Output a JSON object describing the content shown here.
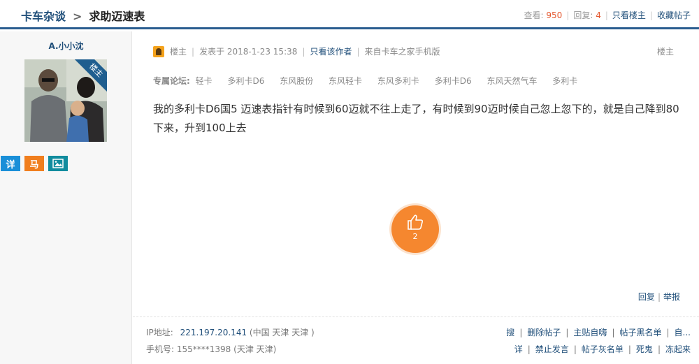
{
  "breadcrumb": {
    "forum": "卡车杂谈",
    "separator": ">",
    "thread_title": "求助迈速表"
  },
  "stats": {
    "views_label": "查看:",
    "views": "950",
    "replies_label": "回复:",
    "replies": "4",
    "only_op": "只看楼主",
    "favorite": "收藏帖子"
  },
  "user": {
    "name": "A.小小沈",
    "corner_badge": "楼主",
    "buttons": [
      {
        "label": "详",
        "color": "#1a8fd8"
      },
      {
        "label": "马",
        "color": "#f07e1e"
      },
      {
        "label": "",
        "icon": "image-icon",
        "color": "#118c9e"
      }
    ]
  },
  "post": {
    "role": "楼主",
    "posted_at": "发表于 2018-1-23 15:38",
    "only_author": "只看该作者",
    "source": "来自卡车之家手机版",
    "floor": "楼主",
    "forums_label": "专属论坛:",
    "forums": [
      "轻卡",
      "多利卡D6",
      "东风股份",
      "东风轻卡",
      "东风多利卡",
      "多利卡D6",
      "东风天然气车",
      "多利卡"
    ],
    "body": "我的多利卡D6国5 迈速表指针有时候到60迈就不往上走了，有时候到90迈时候自己忽上忽下的，就是自己降到80下来，升到100上去",
    "likes": "2",
    "reply": "回复",
    "report": "举报"
  },
  "footer": {
    "ip_label": "IP地址:",
    "ip": "221.197.20.141",
    "ip_location": "(中国 天津 天津 )",
    "phone_label": "手机号:",
    "phone": "155****1398",
    "phone_location": "(天津 天津)",
    "admin_row1": [
      "搜",
      "删除帖子",
      "主贴自嗨",
      "帖子黑名单",
      "自..."
    ],
    "admin_row2": [
      "详",
      "禁止发言",
      "帖子灰名单",
      "死鬼",
      "冻起来"
    ]
  },
  "colors": {
    "accent": "#1f4e79",
    "highlight": "#e4572e",
    "like": "#f5872f"
  }
}
